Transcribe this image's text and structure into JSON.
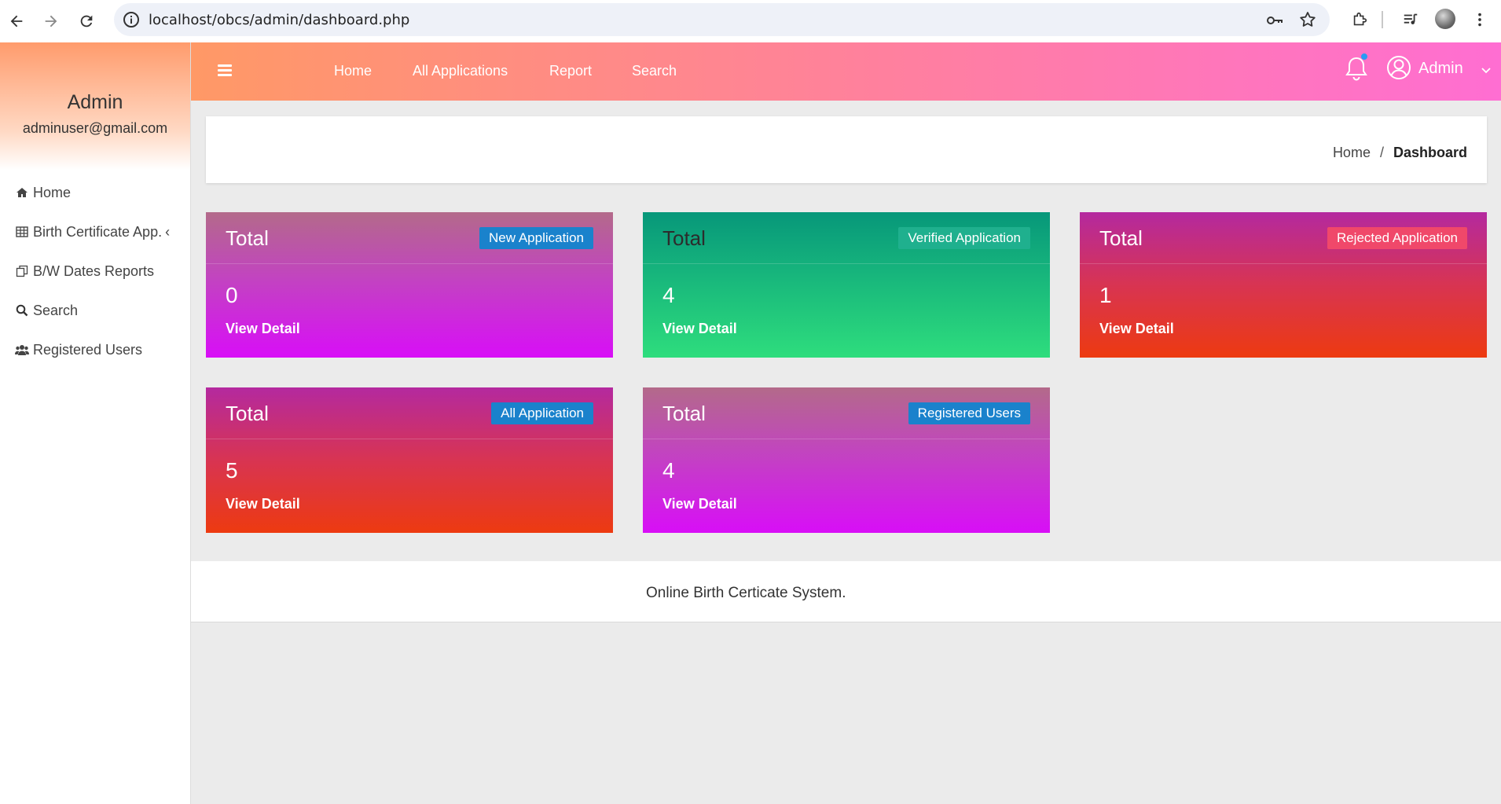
{
  "browser": {
    "url": "localhost/obcs/admin/dashboard.php"
  },
  "sidebar": {
    "profile_name": "Admin",
    "profile_email": "adminuser@gmail.com",
    "items": [
      {
        "label": "Home",
        "icon": "home-icon"
      },
      {
        "label": "Birth Certificate App.",
        "icon": "table-icon",
        "chevron": "‹"
      },
      {
        "label": "B/W Dates Reports",
        "icon": "copy-icon"
      },
      {
        "label": "Search",
        "icon": "search-icon"
      },
      {
        "label": "Registered Users",
        "icon": "users-icon"
      }
    ]
  },
  "topbar": {
    "links": [
      "Home",
      "All Applications",
      "Report",
      "Search"
    ],
    "user_name": "Admin",
    "colors": {
      "start": "#ff9966",
      "middle": "#ff7fa0",
      "end": "#ff6ed2"
    }
  },
  "breadcrumb": {
    "home": "Home",
    "separator": "/",
    "current": "Dashboard"
  },
  "cards": [
    {
      "title": "Total",
      "badge": "New Application",
      "count": "0",
      "link": "View Detail",
      "theme": "purple"
    },
    {
      "title": "Total",
      "badge": "Verified Application",
      "count": "4",
      "link": "View Detail",
      "theme": "green"
    },
    {
      "title": "Total",
      "badge": "Rejected Application",
      "count": "1",
      "link": "View Detail",
      "theme": "red"
    },
    {
      "title": "Total",
      "badge": "All Application",
      "count": "5",
      "link": "View Detail",
      "theme": "red"
    },
    {
      "title": "Total",
      "badge": "Registered Users",
      "count": "4",
      "link": "View Detail",
      "theme": "purple"
    }
  ],
  "footer": {
    "text": "Online Birth Certicate System."
  }
}
